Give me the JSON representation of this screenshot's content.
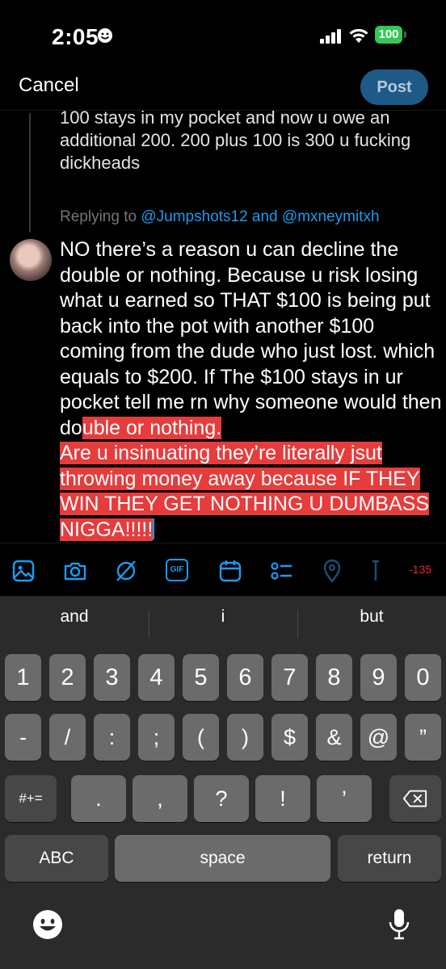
{
  "status_bar": {
    "time": "2:05",
    "battery": "100"
  },
  "header": {
    "cancel_label": "Cancel",
    "post_label": "Post"
  },
  "quoted_tweet": {
    "text": "100 stays in my pocket and now u owe an additional 200. 200 plus 100 is 300 u fucking dickheads"
  },
  "reply": {
    "replying_prefix": "Replying to",
    "mention_1": "@Jumpshots12",
    "and_word": "and",
    "mention_2": "@mxneymitxh",
    "text_plain": "NO there’s a reason u can decline the double or nothing. Because u risk losing what u earned so THAT $100 is being put back into the pot with another $100 coming from the dude who just lost. which equals to $200. If The $100 stays in ur pocket tell me rn why someone would then do",
    "text_selected_1": "uble or nothing.",
    "text_selected_2": "Are u insinuating they’re literally jsut throwing money away because IF THEY WIN THEY GET NOTHING U DUMBASS NIGGA!!!!!"
  },
  "composer_toolbar": {
    "icons": [
      "image-icon",
      "camera-icon",
      "grok-icon",
      "gif-icon",
      "schedule-icon",
      "poll-icon",
      "location-icon",
      "thread-icon"
    ],
    "gif_label": "GIF",
    "char_counter": "-135",
    "accent_color": "#1d9bf0",
    "counter_color": "#f4212e"
  },
  "keyboard": {
    "suggestions": [
      "and",
      "i",
      "but"
    ],
    "row1": [
      "1",
      "2",
      "3",
      "4",
      "5",
      "6",
      "7",
      "8",
      "9",
      "0"
    ],
    "row2": [
      "-",
      "/",
      ":",
      ";",
      "(",
      ")",
      "$",
      "&",
      "@",
      "”"
    ],
    "row3": [
      ".",
      ",",
      "?",
      "!",
      "’"
    ],
    "mode_key": "#+=",
    "abc_key": "ABC",
    "space_key": "space",
    "return_key": "return"
  }
}
